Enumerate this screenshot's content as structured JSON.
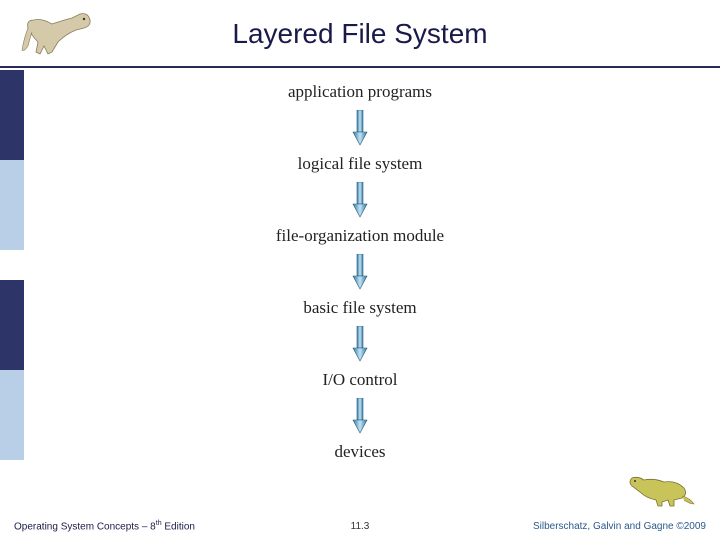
{
  "header": {
    "title": "Layered File System"
  },
  "diagram": {
    "layers": [
      "application programs",
      "logical file system",
      "file-organization module",
      "basic file system",
      "I/O control",
      "devices"
    ]
  },
  "footer": {
    "left_prefix": "Operating System Concepts – 8",
    "left_suffix": " Edition",
    "left_sup": "th",
    "center": "11.3",
    "right": "Silberschatz, Galvin and Gagne ©2009"
  },
  "icons": {
    "dino_top": "dinosaur-icon",
    "dino_bottom": "dinosaur-icon"
  }
}
